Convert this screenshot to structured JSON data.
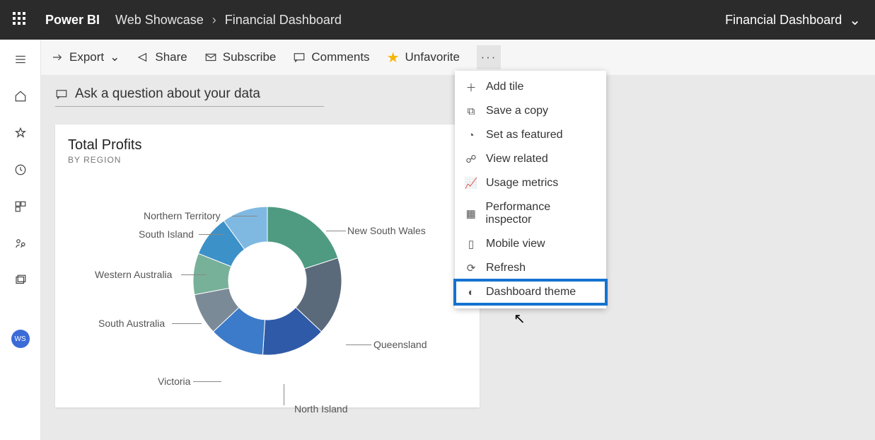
{
  "topbar": {
    "brand": "Power BI",
    "crumb1": "Web Showcase",
    "crumb2": "Financial Dashboard",
    "rightTitle": "Financial Dashboard"
  },
  "actionbar": {
    "export": "Export",
    "share": "Share",
    "subscribe": "Subscribe",
    "comments": "Comments",
    "unfavorite": "Unfavorite"
  },
  "canvas": {
    "ask": "Ask a question about your data"
  },
  "tile": {
    "title": "Total Profits",
    "subtitle": "BY REGION"
  },
  "chart_data": {
    "type": "pie",
    "title": "Total Profits",
    "subtitle": "BY REGION",
    "series": [
      {
        "name": "New South Wales",
        "value": 20,
        "color": "#4f9b82"
      },
      {
        "name": "Queensland",
        "value": 17,
        "color": "#5b6a7a"
      },
      {
        "name": "North Island",
        "value": 14,
        "color": "#2f5aa8"
      },
      {
        "name": "Victoria",
        "value": 12,
        "color": "#3c7bc9"
      },
      {
        "name": "South Australia",
        "value": 9,
        "color": "#7b8a97"
      },
      {
        "name": "Western Australia",
        "value": 9,
        "color": "#78b19a"
      },
      {
        "name": "South Island",
        "value": 9,
        "color": "#3c91c9"
      },
      {
        "name": "Northern Territory",
        "value": 10,
        "color": "#7fb9e2"
      }
    ],
    "innerRadius": 55,
    "outerRadius": 105
  },
  "labels": {
    "nsw": "New South Wales",
    "qld": "Queensland",
    "ni": "North Island",
    "vic": "Victoria",
    "sa": "South Australia",
    "wa": "Western Australia",
    "si": "South Island",
    "nt": "Northern Territory"
  },
  "menu": {
    "addTile": "Add tile",
    "saveCopy": "Save a copy",
    "featured": "Set as featured",
    "related": "View related",
    "usage": "Usage metrics",
    "perf": "Performance inspector",
    "mobile": "Mobile view",
    "refresh": "Refresh",
    "theme": "Dashboard theme"
  },
  "avatar": "WS"
}
